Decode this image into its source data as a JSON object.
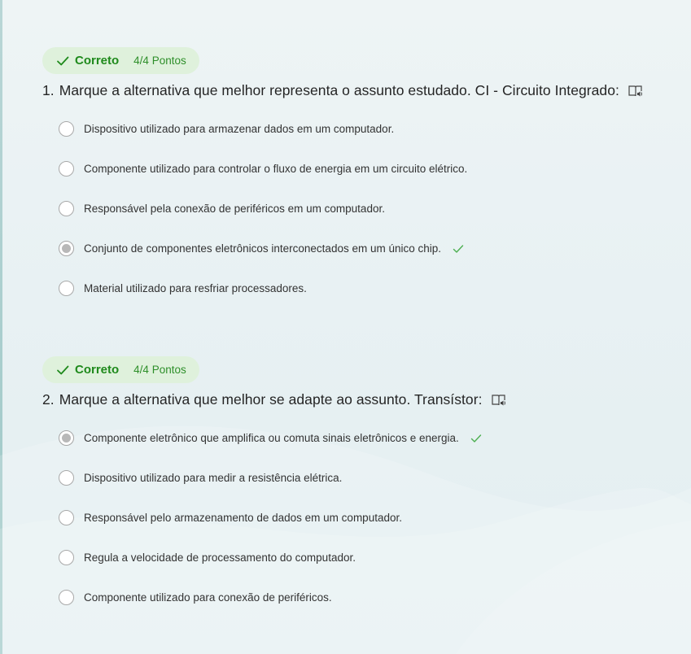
{
  "colors": {
    "badge_bg": "#dff1dc",
    "correct_green": "#1f8a1c",
    "check_green": "#4caf50"
  },
  "questions": [
    {
      "status": "Correto",
      "points": "4/4 Pontos",
      "number": "1.",
      "text": "Marque a alternativa que melhor representa o assunto estudado. CI - Circuito Integrado:",
      "selected_index": 3,
      "correct_index": 3,
      "options": [
        "Dispositivo utilizado para armazenar dados em um computador.",
        "Componente utilizado para controlar o fluxo de energia em um circuito elétrico.",
        "Responsável pela conexão de periféricos em um computador.",
        "Conjunto de componentes eletrônicos interconectados em um único chip.",
        "Material utilizado para resfriar processadores."
      ]
    },
    {
      "status": "Correto",
      "points": "4/4 Pontos",
      "number": "2.",
      "text": "Marque a alternativa que melhor se adapte ao assunto. Transístor:",
      "selected_index": 0,
      "correct_index": 0,
      "options": [
        "Componente eletrônico que amplifica ou comuta sinais eletrônicos e energia.",
        "Dispositivo utilizado para medir a resistência elétrica.",
        "Responsável pelo armazenamento de dados em um computador.",
        "Regula a velocidade de processamento do computador.",
        "Componente utilizado para conexão de periféricos."
      ]
    }
  ]
}
